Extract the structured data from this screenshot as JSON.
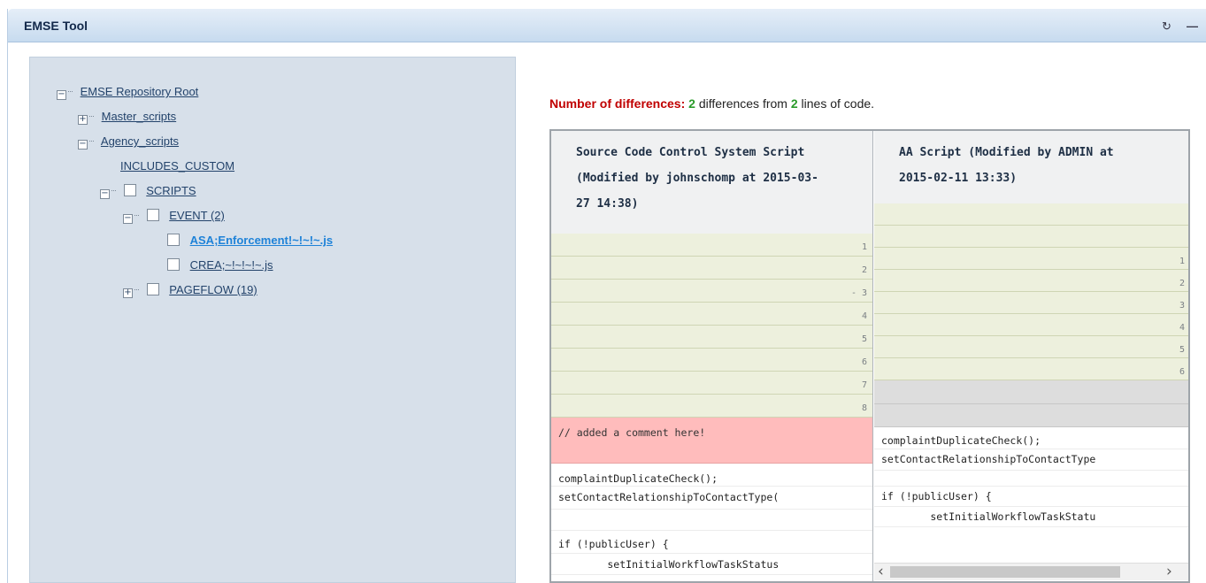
{
  "window": {
    "title": "EMSE Tool",
    "icons": [
      "refresh-icon",
      "minimize-icon"
    ]
  },
  "tree": {
    "root": "EMSE Repository Root",
    "master_scripts": "Master_scripts",
    "agency_scripts": "Agency_scripts",
    "includes_custom": "INCLUDES_CUSTOM",
    "scripts": "SCRIPTS",
    "event": "EVENT (2)",
    "file1": "ASA;Enforcement!~!~!~.js",
    "file2": "CREA;~!~!~!~.js",
    "pageflow": "PAGEFLOW (19)"
  },
  "summary": {
    "label": "Number of differences:",
    "count": "2",
    "middle": " differences from ",
    "lines": "2",
    "suffix": " lines of code."
  },
  "diff": {
    "left_header": "Source Code Control System Script (Modified by johnschomp at 2015-03-27 14:38)",
    "left_header_lines": [
      "Source Code Control System Script",
      "(Modified by johnschomp at 2015-03-",
      "27 14:38)"
    ],
    "right_header_lines": [
      "AA Script (Modified by ADMIN at",
      "2015-02-11 13:33)"
    ],
    "left_line_numbers": [
      "1",
      "2",
      "- 3",
      "4",
      "5",
      "6",
      "7",
      "8"
    ],
    "right_line_numbers": [
      "1",
      "2",
      "3",
      "4",
      "5",
      "6"
    ],
    "left_added_comment": "// added a comment here!",
    "left_code": [
      "complaintDuplicateCheck();",
      "setContactRelationshipToContactType(",
      "",
      "if (!publicUser) {",
      "        setInitialWorkflowTaskStatus"
    ],
    "right_code": [
      "complaintDuplicateCheck();",
      "setContactRelationshipToContactType",
      "",
      "if (!publicUser) {",
      "        setInitialWorkflowTaskStatu"
    ]
  },
  "colors": {
    "summary_label": "#c00000",
    "summary_number": "#2a9b2a",
    "added_line": "#ffbcbc",
    "line_number_bg": "#edf0dd"
  }
}
